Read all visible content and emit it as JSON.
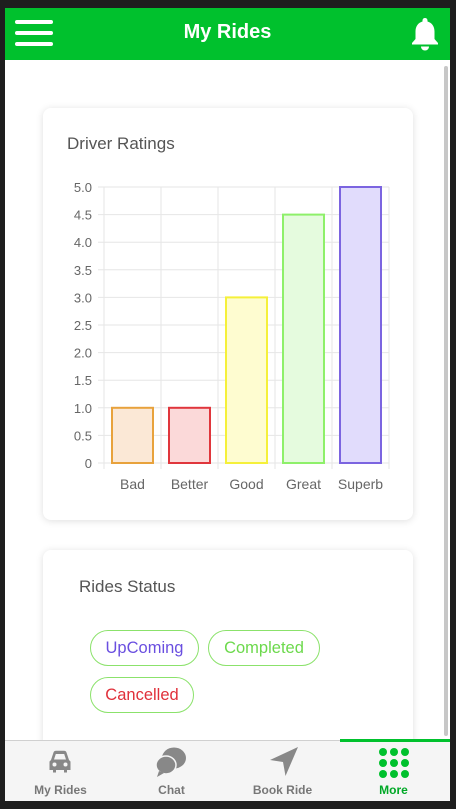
{
  "header": {
    "title": "My Rides",
    "accent_color": "#00c12d",
    "menu_icon": "hamburger-menu-icon",
    "notification_icon": "bell-icon"
  },
  "ratings_card": {
    "title": "Driver Ratings"
  },
  "chart_data": {
    "type": "bar",
    "title": "Driver Ratings",
    "categories": [
      "Bad",
      "Better",
      "Good",
      "Great",
      "Superb"
    ],
    "values": [
      1,
      1,
      3,
      4.5,
      5
    ],
    "ylim": [
      0,
      5
    ],
    "yticks": [
      "0",
      "0.5",
      "1.0",
      "1.5",
      "2.0",
      "2.5",
      "3.0",
      "3.5",
      "4.0",
      "4.5",
      "5.0"
    ],
    "xlabel": "",
    "ylabel": "",
    "grid": true,
    "bar_border_colors": [
      "#e8a23c",
      "#e0363c",
      "#f5f03a",
      "#8ef06a",
      "#7b64e0"
    ],
    "bar_fill_colors": [
      "#fbe8d6",
      "#fbd9d9",
      "#fefcd0",
      "#e5fbde",
      "#e1dcfc"
    ]
  },
  "status_card": {
    "title": "Rides Status",
    "chips": [
      {
        "label": "UpComing",
        "color": "#6a4fe0"
      },
      {
        "label": "Completed",
        "color": "#6cd94c"
      },
      {
        "label": "Cancelled",
        "color": "#e0303a"
      }
    ]
  },
  "tabbar": {
    "tabs": [
      {
        "label": "My Rides",
        "icon": "car-icon"
      },
      {
        "label": "Chat",
        "icon": "chat-icon"
      },
      {
        "label": "Book Ride",
        "icon": "navigation-arrow-icon"
      },
      {
        "label": "More",
        "icon": "grid-dots-icon"
      }
    ],
    "active_tab": "More"
  }
}
